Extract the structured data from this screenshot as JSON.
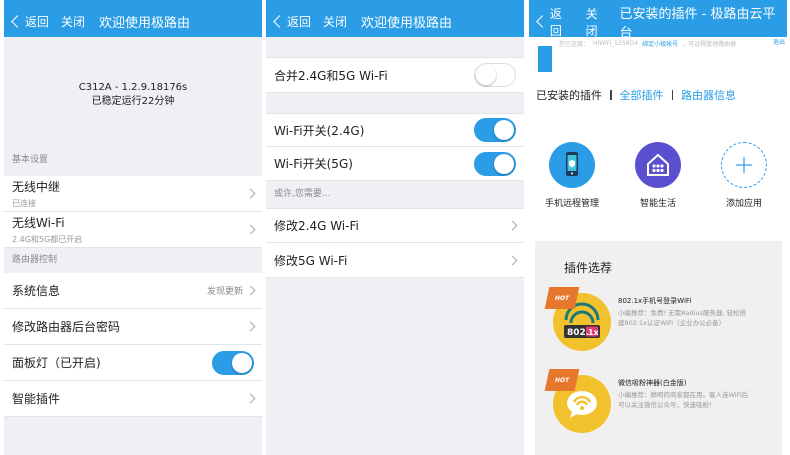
{
  "panel1": {
    "nav": {
      "back": "返回",
      "close": "关闭",
      "title": "欢迎使用极路由"
    },
    "device": {
      "model": "C312A - 1.2.9.18176s",
      "uptime": "已稳定运行22分钟"
    },
    "sections": {
      "basic": "基本设置",
      "router": "路由器控制"
    },
    "rows": {
      "relay": {
        "label": "无线中继",
        "sub": "已连接"
      },
      "wifi": {
        "label": "无线Wi-Fi",
        "sub": "2.4G和5G都已开启"
      },
      "sysinfo": {
        "label": "系统信息",
        "right": "发现更新"
      },
      "password": {
        "label": "修改路由器后台密码"
      },
      "panel_light": {
        "label": "面板灯（已开启)",
        "state": "on"
      },
      "plugins": {
        "label": "智能插件"
      }
    }
  },
  "panel2": {
    "nav": {
      "back": "返回",
      "close": "关闭",
      "title": "欢迎使用极路由"
    },
    "rows": {
      "merge": {
        "label": "合并2.4G和5G Wi-Fi",
        "state": "off"
      },
      "wifi24": {
        "label": "Wi-Fi开关(2.4G)",
        "state": "on"
      },
      "wifi5": {
        "label": "Wi-Fi开关(5G)",
        "state": "on"
      },
      "modify24": {
        "label": "修改2.4G Wi-Fi"
      },
      "modify5": {
        "label": "修改5G Wi-Fi"
      }
    },
    "hint": "或许,您需要..."
  },
  "panel3": {
    "nav": {
      "back": "返回",
      "close": "关闭",
      "title": "已安装的插件 - 极路由云平台"
    },
    "topinfo": {
      "current": "您已连接：",
      "ssid": "HiWiFi_5258D4",
      "bind": "绑定小极帐号",
      "tail": "，可远程管理路由器",
      "logout": "退出"
    },
    "tabs": {
      "installed": "已安装的插件",
      "all": "全部插件",
      "router_info": "路由器信息"
    },
    "apps": [
      {
        "label": "手机远程管理",
        "icon": "phone-remote-icon",
        "color": "#2a9de6"
      },
      {
        "label": "智能生活",
        "icon": "smart-home-icon",
        "color": "#5a4fcf"
      },
      {
        "label": "添加应用",
        "icon": "add-icon",
        "color": "#2a9de6"
      }
    ],
    "picks": {
      "title": "插件选荐",
      "items": [
        {
          "badge": "HOT",
          "name": "802.1x手机号登录WiFi",
          "desc": "小编推荐：免费! 无需Radius服务器, 轻松搭建802.1x认证WiFi（企业办公必备）",
          "icon_text": "802.1x"
        },
        {
          "badge": "HOT",
          "name": "微信吸粉神器(白金版)",
          "desc": "小编推荐：精明的商家都在用。客人连WiFi后可以关注微信公众号，快速吸粉！"
        }
      ]
    }
  },
  "colors": {
    "accent": "#2a9de6",
    "hot": "#e8772e",
    "plugin_yellow": "#f2c12e"
  }
}
